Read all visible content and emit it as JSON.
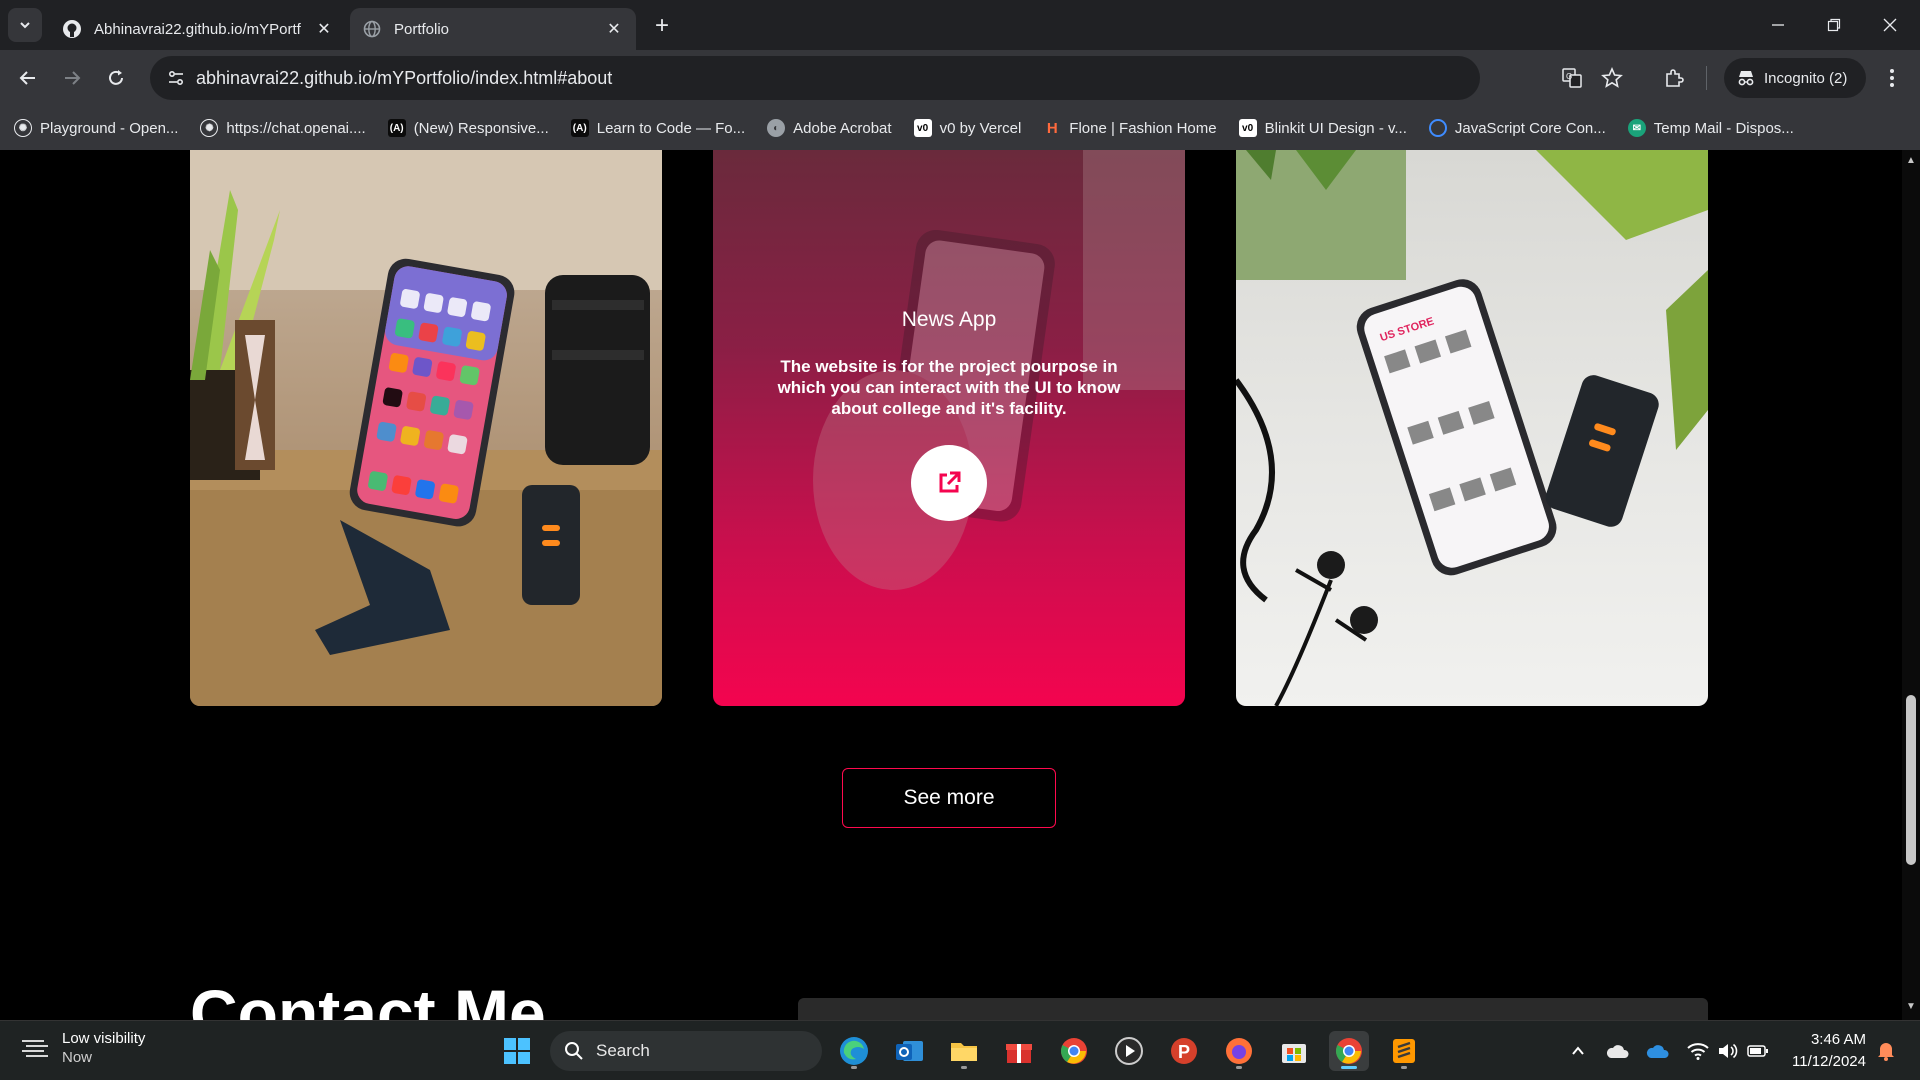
{
  "browser": {
    "tabs": [
      {
        "title": "Abhinavrai22.github.io/mYPortf",
        "icon": "github-icon",
        "active": false
      },
      {
        "title": "Portfolio",
        "icon": "globe-icon",
        "active": true
      }
    ],
    "url": "abhinavrai22.github.io/mYPortfolio/index.html#about",
    "incognito_label": "Incognito (2)",
    "bookmarks": [
      {
        "label": "Playground - Open...",
        "icon": "openai-icon"
      },
      {
        "label": "https://chat.openai....",
        "icon": "openai-icon"
      },
      {
        "label": "(New) Responsive...",
        "icon": "devcode-icon"
      },
      {
        "label": "Learn to Code — Fo...",
        "icon": "devcode-icon"
      },
      {
        "label": "Adobe Acrobat",
        "icon": "globe-icon"
      },
      {
        "label": "v0 by Vercel",
        "icon": "v0-icon"
      },
      {
        "label": "Flone | Fashion Home",
        "icon": "flone-icon"
      },
      {
        "label": "Blinkit UI Design - v...",
        "icon": "v0-icon"
      },
      {
        "label": "JavaScript Core Con...",
        "icon": "search-icon"
      },
      {
        "label": "Temp Mail - Dispos...",
        "icon": "tempmail-icon"
      }
    ]
  },
  "page": {
    "projects": [
      {
        "image": "phone-on-stand-photo"
      },
      {
        "title": "News App",
        "description": "The website is for the project pourpose in which you can interact with the UI to know about college and it's facility.",
        "link_icon": "external-link-icon"
      },
      {
        "image": "store-app-phone-photo"
      }
    ],
    "see_more_label": "See more",
    "contact_title": "Contact Me"
  },
  "taskbar": {
    "weather_title": "Low visibility",
    "weather_sub": "Now",
    "search_label": "Search",
    "time": "3:46 AM",
    "date": "11/12/2024"
  },
  "colors": {
    "accent": "#ff0a4e",
    "chrome_dark": "#202124",
    "chrome": "#35363a"
  }
}
